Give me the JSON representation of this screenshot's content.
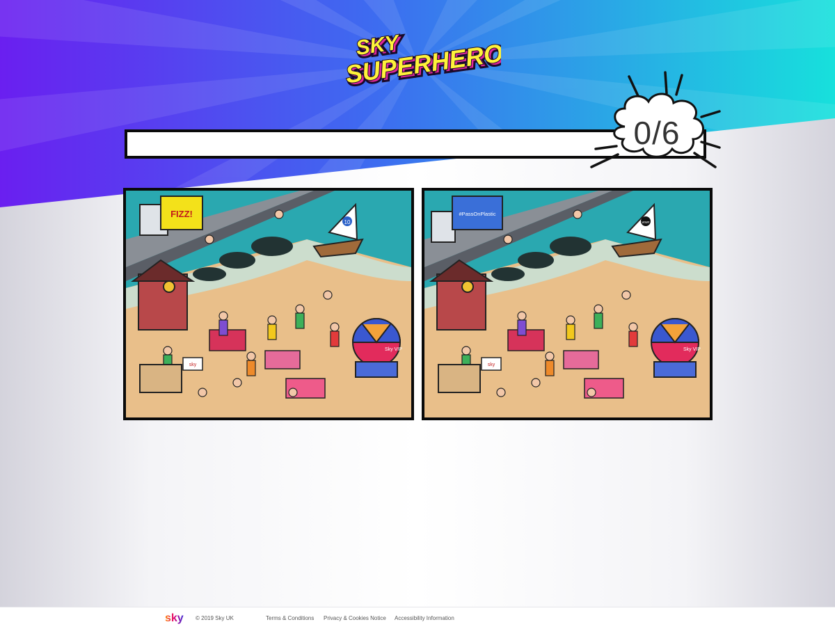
{
  "header": {
    "logo_line1": "SKY",
    "logo_line2": "SUPERHEROES"
  },
  "game": {
    "found": 0,
    "total": 6,
    "counter_text": "0/6",
    "left_image": {
      "truck_sign": "FIZZ!",
      "sail_badge": "10"
    },
    "right_image": {
      "truck_sign": "#PassOnPlastic",
      "sail_badge": "WWF"
    },
    "umbrella_text": "Sky VIP",
    "booth_sign": "sky"
  },
  "colors": {
    "bg_purple": "#6a1ff0",
    "bg_cyan": "#17e0dc",
    "logo_yellow": "#fff23a",
    "logo_pink": "#e0269a",
    "sea": "#2aa8b0",
    "sand": "#e9bf8a"
  },
  "footer": {
    "copyright": "© 2019 Sky UK",
    "links": [
      "Terms & Conditions",
      "Privacy & Cookies Notice",
      "Accessibility Information"
    ]
  }
}
